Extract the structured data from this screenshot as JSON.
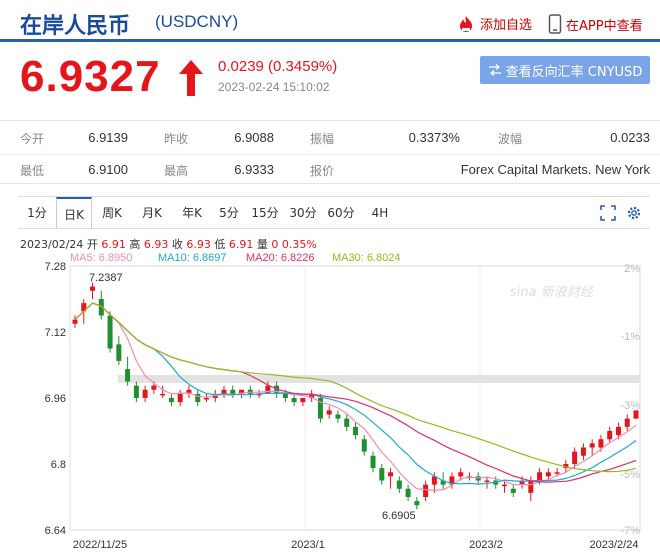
{
  "header": {
    "title": "在岸人民币",
    "code": "(USDCNY)",
    "add_watch": "添加自选",
    "app_view": "在APP中查看"
  },
  "quote": {
    "price": "6.9327",
    "change": "0.0239 (0.3459%)",
    "timestamp": "2023-02-24 15:10:02",
    "reverse_button": "查看反向汇率 CNYUSD",
    "up_color": "#e4161b"
  },
  "stats": {
    "open_label": "今开",
    "open": "6.9139",
    "prev_label": "昨收",
    "prev": "6.9088",
    "amp_label": "振幅",
    "amp": "0.3373%",
    "wave_label": "波幅",
    "wave": "0.0233",
    "low_label": "最低",
    "low": "6.9100",
    "high_label": "最高",
    "high": "6.9333",
    "quote_label": "报价",
    "quote_src": "Forex Capital Markets. New York"
  },
  "tabs": [
    "1分",
    "日K",
    "周K",
    "月K",
    "年K",
    "5分",
    "15分",
    "30分",
    "60分",
    "4H"
  ],
  "active_tab": "日K",
  "ohlc": {
    "date": "2023/02/24",
    "open_label": "开",
    "open": "6.91",
    "high_label": "高",
    "high": "6.93",
    "close_label": "收",
    "close": "6.93",
    "low_label": "低",
    "low": "6.91",
    "vol_label": "量",
    "vol": "0",
    "pct": "0.35%"
  },
  "ma": {
    "ma5": "MA5: 6.8950",
    "ma10": "MA10: 6.8697",
    "ma20": "MA20: 6.8226",
    "ma30": "MA30: 6.8024",
    "colors": {
      "ma5": "#f08cb4",
      "ma10": "#1fa8d6",
      "ma20": "#e0306a",
      "ma30": "#9ab820"
    }
  },
  "chart_data": {
    "type": "candlestick",
    "y_ticks": [
      "7.28",
      "7.12",
      "6.96",
      "6.8",
      "6.64"
    ],
    "pct_ticks": [
      "2%",
      "-1%",
      "-3%",
      "-5%",
      "-7%"
    ],
    "x_ticks": [
      "2022/11/25",
      "2023/1",
      "2023/2",
      "2023/2/24"
    ],
    "annotations": {
      "max": "7.2387",
      "min": "6.6905"
    },
    "watermark": "sina 新浪财经",
    "ylim": [
      6.64,
      7.28
    ],
    "candles": [
      [
        7.14,
        7.16,
        7.13,
        7.15
      ],
      [
        7.17,
        7.2,
        7.14,
        7.19
      ],
      [
        7.22,
        7.24,
        7.2,
        7.23
      ],
      [
        7.2,
        7.22,
        7.15,
        7.16
      ],
      [
        7.16,
        7.17,
        7.07,
        7.08
      ],
      [
        7.09,
        7.11,
        7.04,
        7.05
      ],
      [
        7.03,
        7.06,
        6.99,
        7.0
      ],
      [
        6.99,
        7.0,
        6.95,
        6.96
      ],
      [
        6.96,
        6.99,
        6.95,
        6.98
      ],
      [
        6.98,
        7.0,
        6.97,
        6.99
      ],
      [
        6.97,
        6.99,
        6.96,
        6.97
      ],
      [
        6.96,
        6.97,
        6.94,
        6.95
      ],
      [
        6.95,
        6.98,
        6.94,
        6.97
      ],
      [
        6.97,
        6.99,
        6.96,
        6.98
      ],
      [
        6.97,
        6.98,
        6.94,
        6.95
      ],
      [
        6.96,
        6.97,
        6.95,
        6.96
      ],
      [
        6.96,
        6.98,
        6.95,
        6.97
      ],
      [
        6.97,
        6.99,
        6.96,
        6.98
      ],
      [
        6.98,
        6.99,
        6.96,
        6.97
      ],
      [
        6.97,
        6.98,
        6.96,
        6.98
      ],
      [
        6.98,
        6.99,
        6.96,
        6.97
      ],
      [
        6.97,
        6.98,
        6.96,
        6.97
      ],
      [
        6.97,
        7.0,
        6.97,
        6.99
      ],
      [
        6.99,
        7.0,
        6.96,
        6.97
      ],
      [
        6.97,
        6.98,
        6.95,
        6.96
      ],
      [
        6.96,
        6.97,
        6.94,
        6.95
      ],
      [
        6.95,
        6.96,
        6.94,
        6.96
      ],
      [
        6.96,
        6.98,
        6.95,
        6.97
      ],
      [
        6.96,
        6.97,
        6.9,
        6.91
      ],
      [
        6.92,
        6.94,
        6.91,
        6.93
      ],
      [
        6.92,
        6.93,
        6.9,
        6.91
      ],
      [
        6.91,
        6.92,
        6.88,
        6.89
      ],
      [
        6.89,
        6.9,
        6.86,
        6.87
      ],
      [
        6.86,
        6.87,
        6.82,
        6.83
      ],
      [
        6.82,
        6.83,
        6.78,
        6.79
      ],
      [
        6.79,
        6.8,
        6.75,
        6.76
      ],
      [
        6.77,
        6.79,
        6.74,
        6.78
      ],
      [
        6.76,
        6.77,
        6.73,
        6.74
      ],
      [
        6.74,
        6.75,
        6.71,
        6.72
      ],
      [
        6.71,
        6.72,
        6.69,
        6.7
      ],
      [
        6.72,
        6.76,
        6.71,
        6.75
      ],
      [
        6.75,
        6.78,
        6.73,
        6.77
      ],
      [
        6.76,
        6.78,
        6.74,
        6.75
      ],
      [
        6.75,
        6.78,
        6.74,
        6.77
      ],
      [
        6.77,
        6.79,
        6.76,
        6.78
      ],
      [
        6.77,
        6.78,
        6.76,
        6.77
      ],
      [
        6.77,
        6.78,
        6.75,
        6.76
      ],
      [
        6.76,
        6.77,
        6.74,
        6.76
      ],
      [
        6.76,
        6.77,
        6.74,
        6.75
      ],
      [
        6.75,
        6.76,
        6.73,
        6.75
      ],
      [
        6.74,
        6.75,
        6.72,
        6.73
      ],
      [
        6.75,
        6.77,
        6.74,
        6.76
      ],
      [
        6.73,
        6.77,
        6.71,
        6.76
      ],
      [
        6.76,
        6.79,
        6.75,
        6.78
      ],
      [
        6.77,
        6.79,
        6.76,
        6.78
      ],
      [
        6.78,
        6.79,
        6.77,
        6.78
      ],
      [
        6.79,
        6.81,
        6.78,
        6.8
      ],
      [
        6.8,
        6.84,
        6.79,
        6.83
      ],
      [
        6.82,
        6.85,
        6.81,
        6.84
      ],
      [
        6.84,
        6.86,
        6.82,
        6.85
      ],
      [
        6.84,
        6.87,
        6.83,
        6.86
      ],
      [
        6.86,
        6.89,
        6.85,
        6.88
      ],
      [
        6.87,
        6.9,
        6.86,
        6.89
      ],
      [
        6.89,
        6.92,
        6.88,
        6.91
      ],
      [
        6.91,
        6.93,
        6.91,
        6.93
      ]
    ]
  }
}
